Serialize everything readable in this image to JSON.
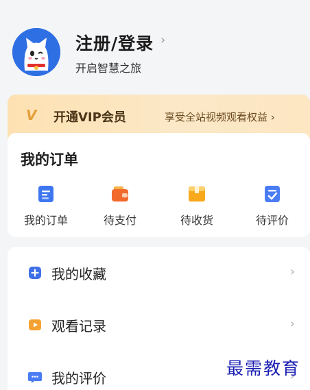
{
  "profile": {
    "login_title": "注册/登录",
    "login_chevron": "›",
    "subtitle": "开启智慧之旅",
    "avatar_icon": "cat-mascot-icon"
  },
  "vip": {
    "badge": "V",
    "label": "开通VIP会员",
    "benefit": "享受全站视频观看权益 ›",
    "colors": {
      "gradient_start": "#fde1b2",
      "gradient_end": "#fde6c2",
      "badge": "#e3a03a"
    }
  },
  "orders": {
    "title": "我的订单",
    "items": [
      {
        "label": "我的订单",
        "icon": "order-list-icon",
        "color": "#3e76f0"
      },
      {
        "label": "待支付",
        "icon": "wallet-icon",
        "color": "#f26a2b"
      },
      {
        "label": "待收货",
        "icon": "package-icon",
        "color": "#f7a81b"
      },
      {
        "label": "待评价",
        "icon": "review-check-icon",
        "color": "#4a7cf4"
      }
    ]
  },
  "list": {
    "items": [
      {
        "label": "我的收藏",
        "icon": "favorites-plus-icon",
        "color": "#3f6fe8",
        "chevron": "›"
      },
      {
        "label": "观看记录",
        "icon": "play-history-icon",
        "color": "#f3a232",
        "chevron": "›"
      },
      {
        "label": "我的评价",
        "icon": "comment-icon",
        "color": "#4a7cf4",
        "chevron": "›"
      }
    ]
  },
  "watermark": {
    "text": "最需教育"
  }
}
